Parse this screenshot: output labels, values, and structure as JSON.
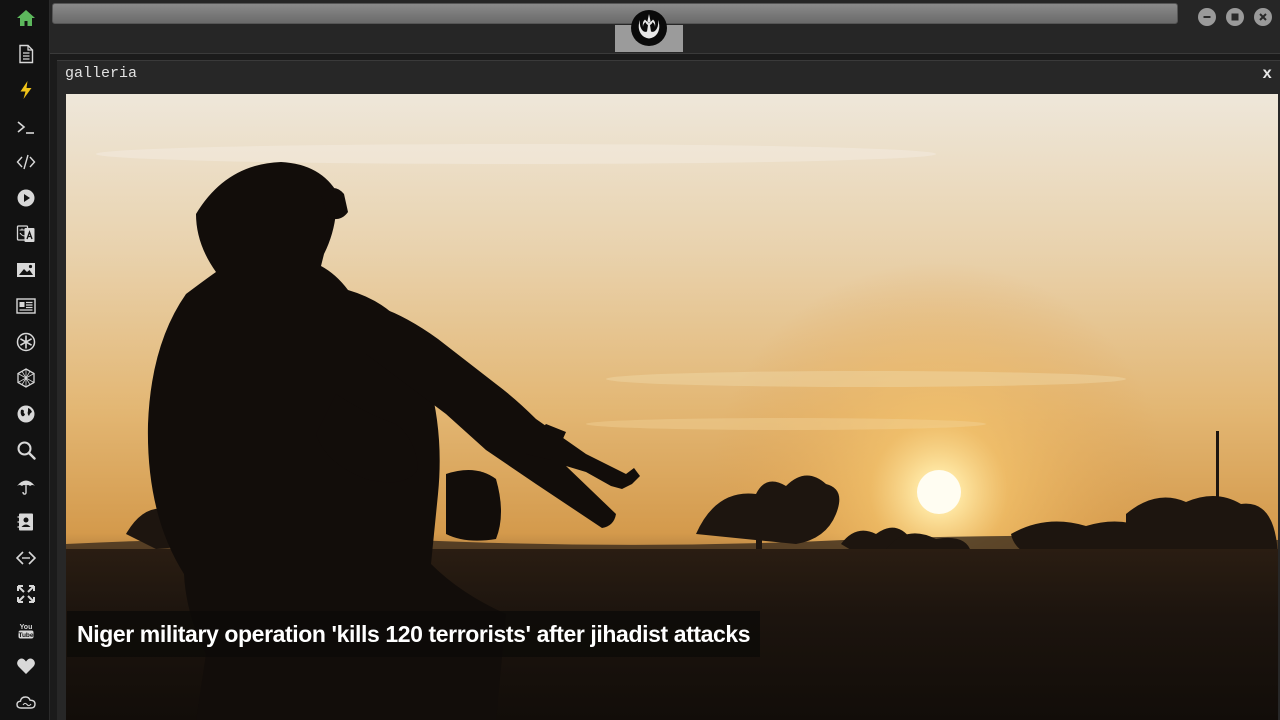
{
  "window": {
    "panel_title": "galleria",
    "close_label": "x"
  },
  "gallery": {
    "caption": "Niger military operation 'kills 120 terrorists' after jihadist attacks"
  },
  "sidebar": {
    "items": [
      {
        "name": "home",
        "icon": "home-icon",
        "active": true
      },
      {
        "name": "document",
        "icon": "document-icon"
      },
      {
        "name": "lightning",
        "icon": "lightning-icon"
      },
      {
        "name": "terminal",
        "icon": "terminal-icon"
      },
      {
        "name": "code",
        "icon": "code-icon"
      },
      {
        "name": "play",
        "icon": "play-icon"
      },
      {
        "name": "translate",
        "icon": "translate-icon"
      },
      {
        "name": "image",
        "icon": "image-icon"
      },
      {
        "name": "news",
        "icon": "newspaper-icon"
      },
      {
        "name": "rebel",
        "icon": "rebel-alliance-icon"
      },
      {
        "name": "hexagon",
        "icon": "hexagon-network-icon"
      },
      {
        "name": "globe",
        "icon": "globe-icon"
      },
      {
        "name": "search",
        "icon": "search-icon"
      },
      {
        "name": "weather",
        "icon": "umbrella-icon"
      },
      {
        "name": "contacts",
        "icon": "contact-book-icon"
      },
      {
        "name": "connect",
        "icon": "diamond-link-icon"
      },
      {
        "name": "expand",
        "icon": "expand-icon"
      },
      {
        "name": "youtube",
        "icon": "youtube-icon"
      },
      {
        "name": "favorites",
        "icon": "heart-icon"
      },
      {
        "name": "cloud",
        "icon": "cloud-icon"
      }
    ]
  },
  "colors": {
    "active_icon": "#5cb85c",
    "bolt_icon": "#f0c419",
    "sidebar_bg": "#121212",
    "panel_bg": "#272727"
  }
}
